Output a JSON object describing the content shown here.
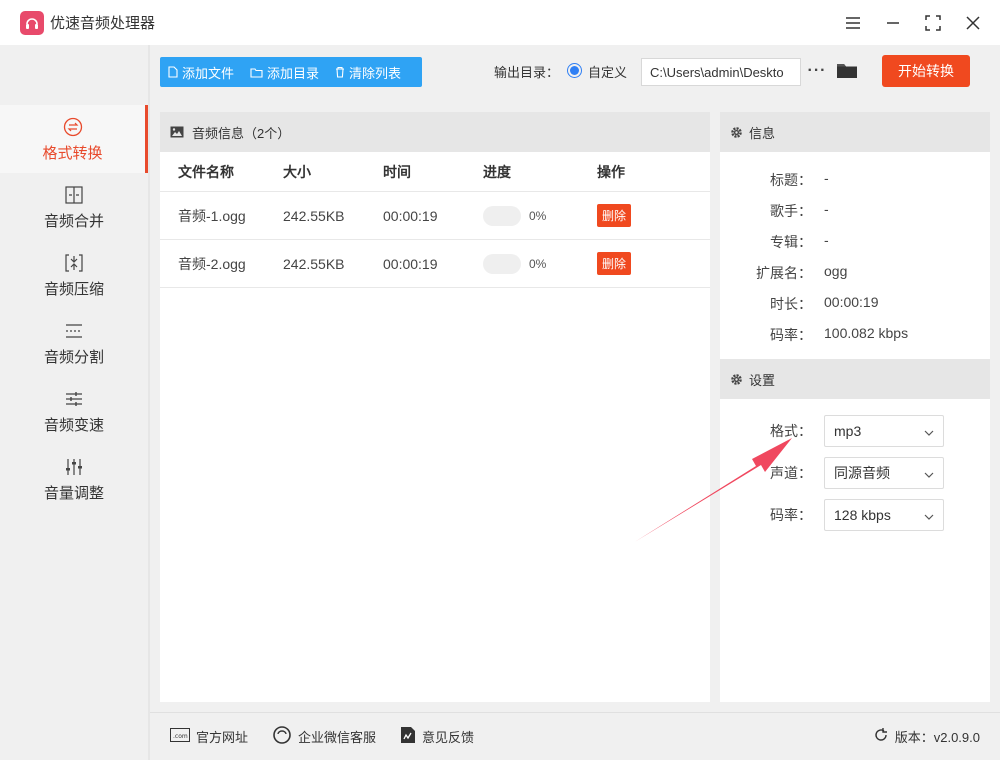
{
  "app": {
    "title": "优速音频处理器"
  },
  "sidebar": {
    "items": [
      {
        "label": "格式转换",
        "icon": "format-convert-icon",
        "active": true
      },
      {
        "label": "音频合并",
        "icon": "merge-icon"
      },
      {
        "label": "音频压缩",
        "icon": "compress-icon"
      },
      {
        "label": "音频分割",
        "icon": "split-icon"
      },
      {
        "label": "音频变速",
        "icon": "speed-icon"
      },
      {
        "label": "音量调整",
        "icon": "volume-icon"
      }
    ]
  },
  "toolbar": {
    "add_file": "添加文件",
    "add_dir": "添加目录",
    "clear_list": "清除列表",
    "output_label": "输出目录：",
    "custom_label": "自定义",
    "output_path": "C:\\Users\\admin\\Deskto",
    "more": "···",
    "start": "开始转换"
  },
  "list": {
    "title": "音频信息（2个）",
    "columns": [
      "文件名称",
      "大小",
      "时间",
      "进度",
      "操作"
    ],
    "rows": [
      {
        "name": "音频-1.ogg",
        "size": "242.55KB",
        "time": "00:00:19",
        "progress": "0%",
        "action": "删除"
      },
      {
        "name": "音频-2.ogg",
        "size": "242.55KB",
        "time": "00:00:19",
        "progress": "0%",
        "action": "删除"
      }
    ]
  },
  "info": {
    "title": "信息",
    "fields": [
      {
        "label": "标题：",
        "value": "-"
      },
      {
        "label": "歌手：",
        "value": "-"
      },
      {
        "label": "专辑：",
        "value": "-"
      },
      {
        "label": "扩展名：",
        "value": "ogg"
      },
      {
        "label": "时长：",
        "value": "00:00:19"
      },
      {
        "label": "码率：",
        "value": "100.082 kbps"
      }
    ]
  },
  "settings": {
    "title": "设置",
    "format": {
      "label": "格式：",
      "value": "mp3"
    },
    "channel": {
      "label": "声道：",
      "value": "同源音频"
    },
    "bitrate": {
      "label": "码率：",
      "value": "128 kbps"
    }
  },
  "footer": {
    "website": "官方网址",
    "wechat": "企业微信客服",
    "feedback": "意见反馈",
    "version": "版本：v2.0.9.0"
  },
  "colors": {
    "accent": "#f0491f",
    "toolbar_blue": "#2fa3f4",
    "radio_blue": "#2f7ff4",
    "arrow": "#f0485f"
  }
}
